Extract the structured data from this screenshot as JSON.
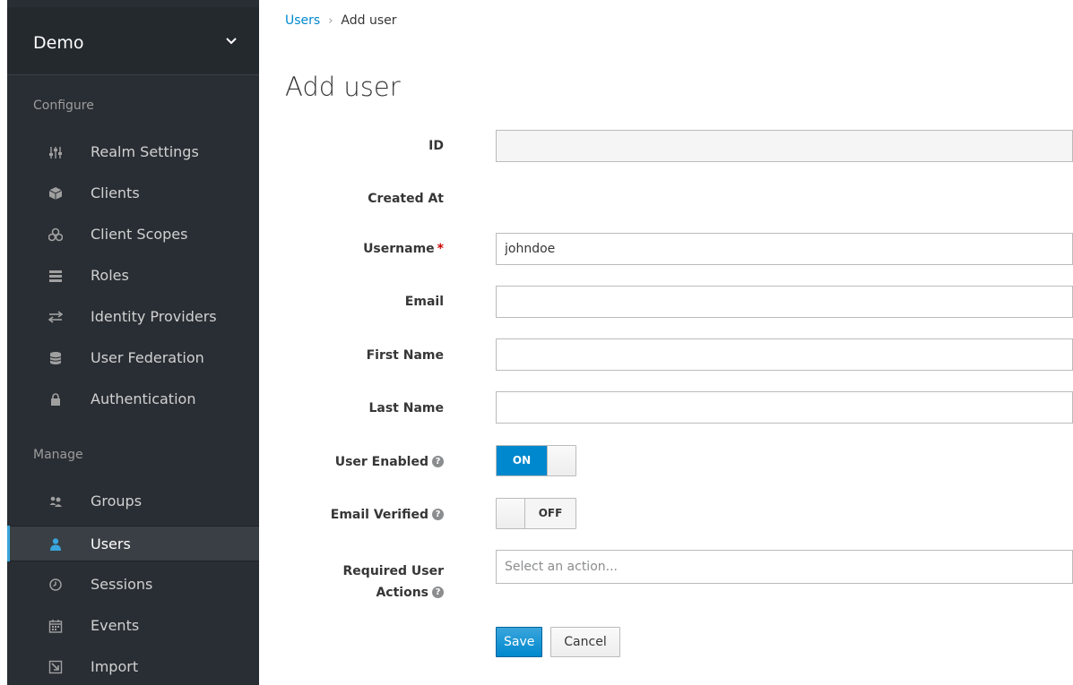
{
  "sidebar": {
    "realm": "Demo",
    "configure_label": "Configure",
    "manage_label": "Manage",
    "configure_items": [
      {
        "label": "Realm Settings",
        "icon": "sliders-icon"
      },
      {
        "label": "Clients",
        "icon": "cube-icon"
      },
      {
        "label": "Client Scopes",
        "icon": "cubes-icon"
      },
      {
        "label": "Roles",
        "icon": "roles-list-icon"
      },
      {
        "label": "Identity Providers",
        "icon": "exchange-icon"
      },
      {
        "label": "User Federation",
        "icon": "database-icon"
      },
      {
        "label": "Authentication",
        "icon": "lock-icon"
      }
    ],
    "manage_items": [
      {
        "label": "Groups",
        "icon": "users-icon"
      },
      {
        "label": "Users",
        "icon": "user-icon",
        "active": true
      },
      {
        "label": "Sessions",
        "icon": "clock-icon"
      },
      {
        "label": "Events",
        "icon": "calendar-icon"
      },
      {
        "label": "Import",
        "icon": "import-icon"
      }
    ]
  },
  "breadcrumb": {
    "parent": "Users",
    "separator": "›",
    "current": "Add user"
  },
  "page": {
    "title": "Add user"
  },
  "form": {
    "id_label": "ID",
    "id_value": "",
    "created_at_label": "Created At",
    "username_label": "Username",
    "username_required": "*",
    "username_value": "johndoe",
    "email_label": "Email",
    "email_value": "",
    "first_name_label": "First Name",
    "first_name_value": "",
    "last_name_label": "Last Name",
    "last_name_value": "",
    "user_enabled_label": "User Enabled",
    "user_enabled_state": "ON",
    "email_verified_label": "Email Verified",
    "email_verified_state": "OFF",
    "required_actions_label_line1": "Required User",
    "required_actions_label_line2": "Actions",
    "required_actions_placeholder": "Select an action...",
    "help_glyph": "?"
  },
  "buttons": {
    "save": "Save",
    "cancel": "Cancel"
  },
  "colors": {
    "sidebar_bg": "#292e34",
    "accent": "#0088ce",
    "active_bar": "#39a5dc"
  }
}
